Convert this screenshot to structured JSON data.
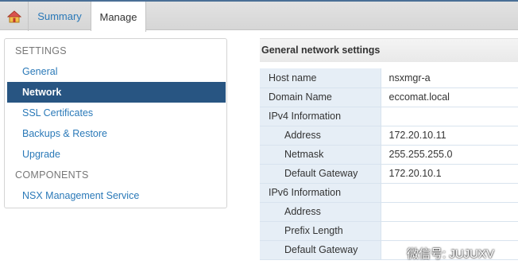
{
  "tabs": {
    "summary": "Summary",
    "manage": "Manage"
  },
  "sidebar": {
    "settings_heading": "SETTINGS",
    "items": [
      {
        "label": "General"
      },
      {
        "label": "Network"
      },
      {
        "label": "SSL Certificates"
      },
      {
        "label": "Backups & Restore"
      },
      {
        "label": "Upgrade"
      }
    ],
    "components_heading": "COMPONENTS",
    "component_items": [
      {
        "label": "NSX Management Service"
      }
    ],
    "selected": "Network"
  },
  "main": {
    "title": "General network settings",
    "rows": [
      {
        "label": "Host name",
        "value": "nsxmgr-a"
      },
      {
        "label": "Domain Name",
        "value": "eccomat.local"
      },
      {
        "label": "IPv4 Information",
        "value": ""
      },
      {
        "label": "Address",
        "value": "172.20.10.11"
      },
      {
        "label": "Netmask",
        "value": "255.255.255.0"
      },
      {
        "label": "Default Gateway",
        "value": "172.20.10.1"
      },
      {
        "label": "IPv6 Information",
        "value": ""
      },
      {
        "label": "Address",
        "value": ""
      },
      {
        "label": "Prefix Length",
        "value": ""
      },
      {
        "label": "Default Gateway",
        "value": ""
      }
    ]
  },
  "watermark": {
    "text": "微信号: JUJUXV"
  },
  "colors": {
    "selected_bg": "#285582",
    "link": "#2a79b8",
    "label_cell_bg": "#e6eef6"
  }
}
